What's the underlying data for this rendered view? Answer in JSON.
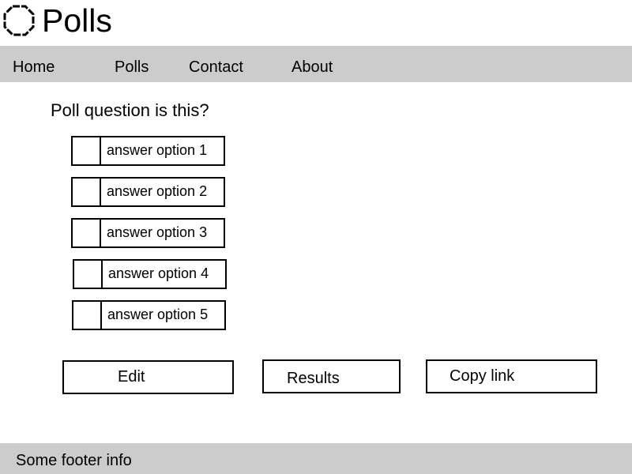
{
  "header": {
    "title": "Polls",
    "logo_icon": "octagon-icon"
  },
  "nav": {
    "items": [
      {
        "label": "Home"
      },
      {
        "label": "Polls"
      },
      {
        "label": "Contact"
      },
      {
        "label": "About"
      }
    ]
  },
  "poll": {
    "question": "Poll question is this?",
    "options": [
      {
        "label": "answer option 1",
        "checked": false
      },
      {
        "label": "answer option 2",
        "checked": false
      },
      {
        "label": "answer option 3",
        "checked": false
      },
      {
        "label": "answer option 4",
        "checked": false
      },
      {
        "label": "answer option 5",
        "checked": false
      }
    ]
  },
  "actions": {
    "edit_label": "Edit",
    "results_label": "Results",
    "copy_link_label": "Copy link"
  },
  "footer": {
    "text": "Some footer info"
  },
  "colors": {
    "bar_background": "#cccccc",
    "page_background": "#ffffff",
    "border": "#000000"
  }
}
